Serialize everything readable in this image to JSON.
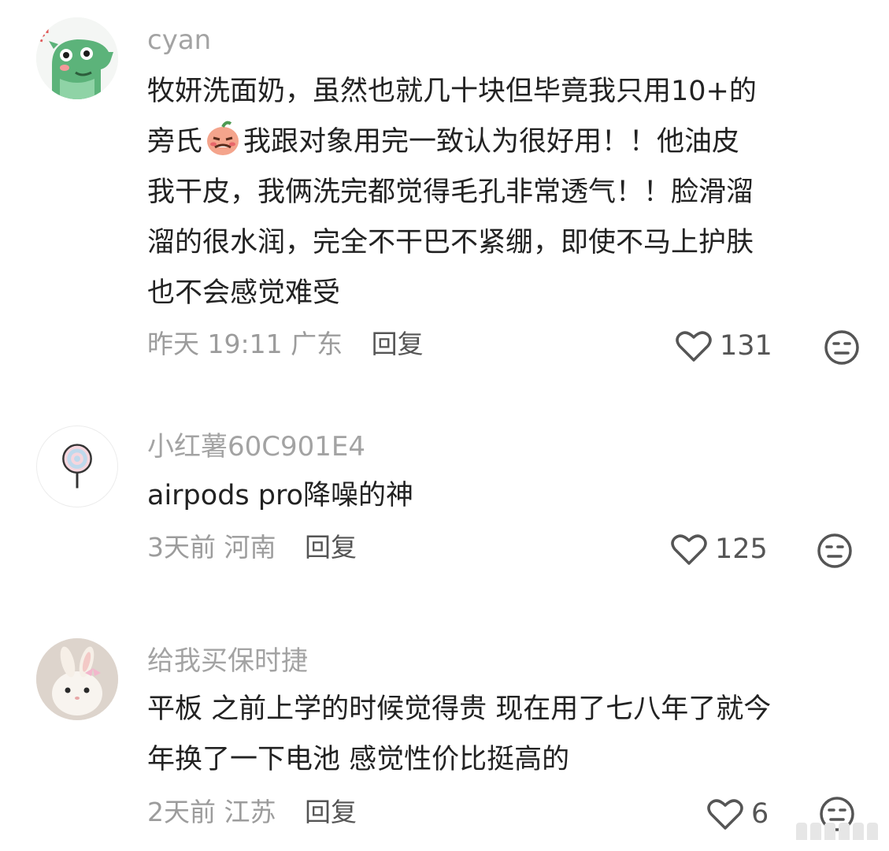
{
  "comments": [
    {
      "username": "cyan",
      "avatar": "green-dinosaur-avatar",
      "lines": [
        "牧妍洗面奶，虽然也就几十块但毕竟我只用10+的",
        "我跟对象用完一致认为很好用！！他油皮",
        "我干皮，我俩洗完都觉得毛孔非常透气！！脸滑溜",
        "溜的很水润，完全不干巴不紧绷，即使不马上护肤",
        "也不会感觉难受"
      ],
      "line2_prefix": "旁氏",
      "inline_emoji": "embarrassed-face-emoji",
      "time": "昨天 19:11",
      "location": "广东",
      "reply_label": "回复",
      "likes": "131"
    },
    {
      "username": "小红薯60C901E4",
      "avatar": "lollipop-avatar",
      "lines": [
        "airpods pro降噪的神"
      ],
      "time": "3天前",
      "location": "河南",
      "reply_label": "回复",
      "likes": "125"
    },
    {
      "username": "给我买保时捷",
      "avatar": "bunny-photo-avatar",
      "lines": [
        "平板 之前上学的时候觉得贵 现在用了七八年了就今",
        "年换了一下电池 感觉性价比挺高的"
      ],
      "time": "2天前",
      "location": "江苏",
      "reply_label": "回复",
      "likes": "6"
    }
  ],
  "colors": {
    "username": "#a3a3a3",
    "text": "#222222",
    "meta": "#9c9c9c",
    "accent_green": "#5cb37a"
  },
  "icons": {
    "like": "heart-outline-icon",
    "dislike": "neutral-face-icon"
  }
}
